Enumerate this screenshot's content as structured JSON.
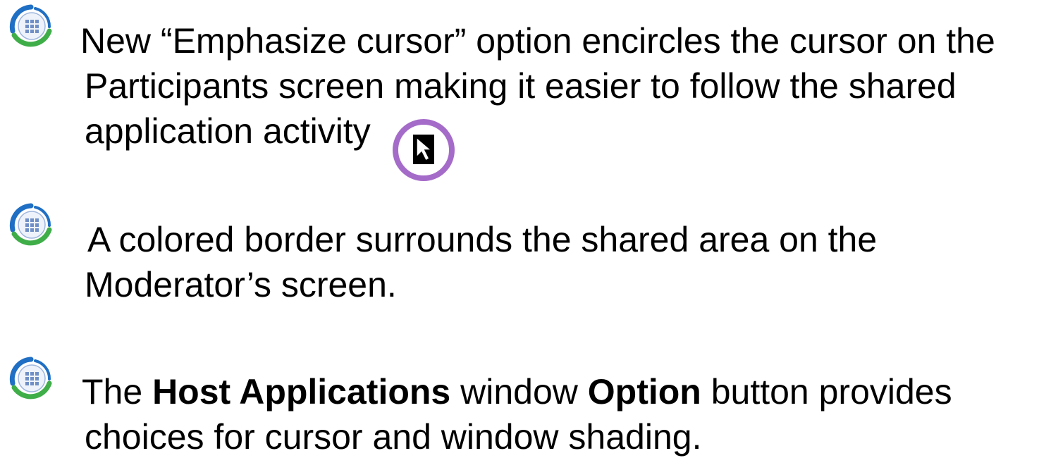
{
  "bullets": [
    {
      "icon": "app-grid-bullet-icon",
      "lines": [
        "New “Emphasize cursor” option encircles the cursor on the",
        "Participants screen making it easier  to follow the shared",
        "application activity"
      ],
      "inline_icon": "emphasized-cursor-icon"
    },
    {
      "icon": "app-grid-bullet-icon",
      "lines": [
        "A colored border surrounds the shared area on the",
        "Moderator’s screen."
      ]
    },
    {
      "icon": "app-grid-bullet-icon",
      "line1": {
        "t1": "The ",
        "b1": "Host Applications",
        "t2": " window ",
        "b2": "Option",
        "t3": " button provides"
      },
      "line2": "choices for cursor and window shading."
    }
  ],
  "colors": {
    "ring_blue": "#1f6fc4",
    "ring_green": "#3fae49",
    "grid_tile": "#6f8fc6",
    "cursor_ring": "#a56bc9"
  }
}
